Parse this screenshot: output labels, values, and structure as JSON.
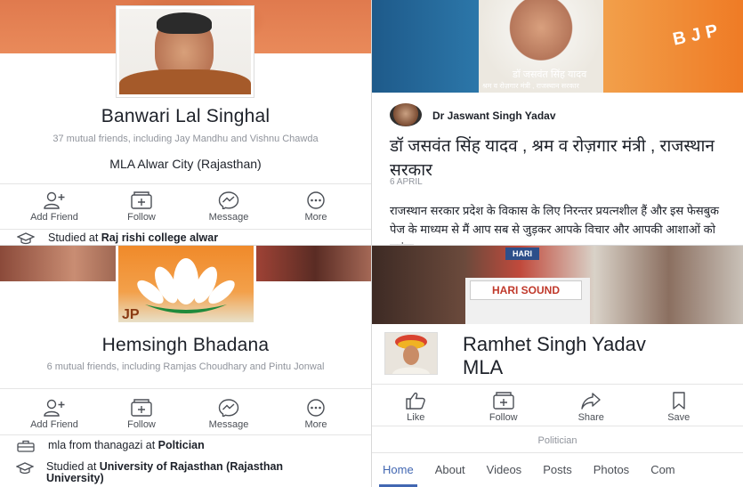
{
  "colors": {
    "accent": "#4267b2",
    "text": "#1d2129",
    "muted": "#90949c",
    "bjp_orange": "#ef7b25"
  },
  "panels": {
    "banwari": {
      "name": "Banwari Lal Singhal",
      "mutual": "37 mutual friends, including Jay Mandhu and Vishnu Chawda",
      "role": "MLA Alwar City (Rajasthan)",
      "actions": [
        {
          "label": "Add Friend",
          "icon": "add-friend-icon"
        },
        {
          "label": "Follow",
          "icon": "follow-icon"
        },
        {
          "label": "Message",
          "icon": "messenger-icon"
        },
        {
          "label": "More",
          "icon": "more-icon"
        }
      ],
      "education_prefix": "Studied at ",
      "education_school": "Raj rishi college alwar"
    },
    "jaswant": {
      "cover_caption": "डॉ जसवंत सिंह यादव",
      "cover_subcaption": "श्रम व रोज़गार मंत्री , राजस्थान सरकार",
      "cover_party": "BJP",
      "author": "Dr Jaswant Singh Yadav",
      "title": "डॉ जसवंत सिंह यादव , श्रम व रोज़गार मंत्री , राजस्थान सरकार",
      "date": "6 APRIL",
      "body": "राजस्थान सरकार प्रदेश के विकास के लिए निरन्तर प्रयत्नशील हैं और इस फेसबुक पेज के माध्यम से मैं आप सब से जुड़कर आपके विचार और आपकी आशाओं को सुनूंगा"
    },
    "hemsingh": {
      "name": "Hemsingh Bhadana",
      "mutual": "6 mutual friends, including Ramjas Choudhary and Pintu Jonwal",
      "actions": [
        {
          "label": "Add Friend",
          "icon": "add-friend-icon"
        },
        {
          "label": "Follow",
          "icon": "follow-icon"
        },
        {
          "label": "Message",
          "icon": "messenger-icon"
        },
        {
          "label": "More",
          "icon": "more-icon"
        }
      ],
      "work_prefix": "mla from thanagazi at ",
      "work_place": "Poltician",
      "education_prefix": "Studied at ",
      "education_school": "University of Rajasthan (Rajasthan University)"
    },
    "ramhet": {
      "cover_banner": "HARI SOUND",
      "cover_sign": "HARI",
      "name_line1": "Ramhet Singh Yadav",
      "name_line2": "MLA",
      "actions": [
        {
          "label": "Like",
          "icon": "like-icon"
        },
        {
          "label": "Follow",
          "icon": "follow-icon"
        },
        {
          "label": "Share",
          "icon": "share-icon"
        },
        {
          "label": "Save",
          "icon": "bookmark-icon"
        }
      ],
      "category": "Politician",
      "tabs": [
        "Home",
        "About",
        "Videos",
        "Posts",
        "Photos",
        "Com"
      ],
      "active_tab": "Home"
    }
  }
}
